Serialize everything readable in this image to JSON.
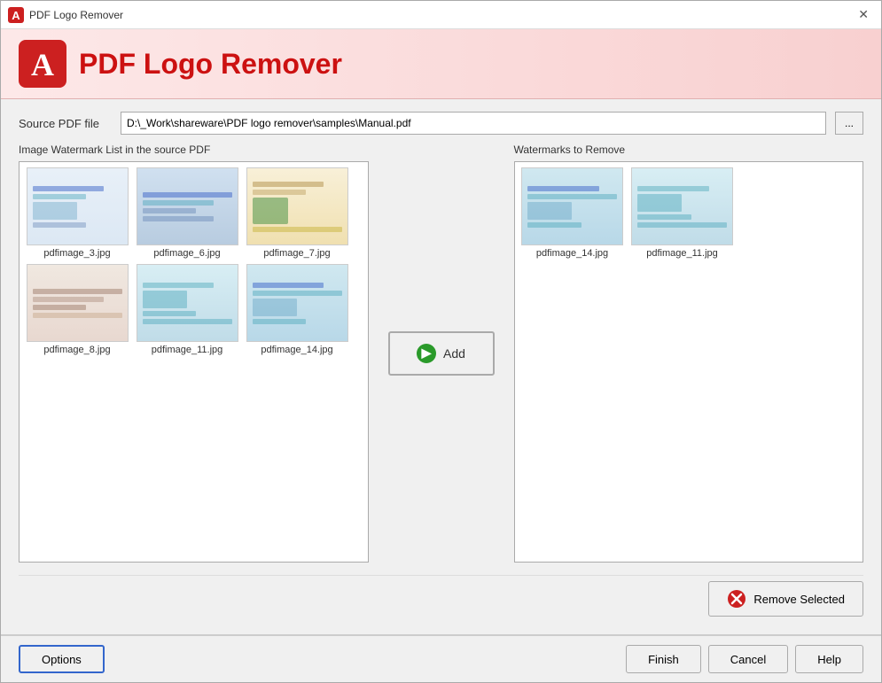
{
  "titleBar": {
    "icon": "pdf-logo-icon",
    "text": "PDF Logo Remover",
    "closeLabel": "✕"
  },
  "header": {
    "title": "PDF Logo Remover"
  },
  "sourceFile": {
    "label": "Source PDF file",
    "value": "D:\\_Work\\shareware\\PDF logo remover\\samples\\Manual.pdf",
    "browseBtnLabel": "..."
  },
  "leftPanel": {
    "label": "Image Watermark List in the source PDF",
    "items": [
      {
        "id": "pdfimage_3",
        "label": "pdfimage_3.jpg",
        "thumbClass": "thumb-3"
      },
      {
        "id": "pdfimage_6",
        "label": "pdfimage_6.jpg",
        "thumbClass": "thumb-6"
      },
      {
        "id": "pdfimage_7",
        "label": "pdfimage_7.jpg",
        "thumbClass": "thumb-7"
      },
      {
        "id": "pdfimage_8",
        "label": "pdfimage_8.jpg",
        "thumbClass": "thumb-8"
      },
      {
        "id": "pdfimage_11",
        "label": "pdfimage_11.jpg",
        "thumbClass": "thumb-11"
      },
      {
        "id": "pdfimage_14",
        "label": "pdfimage_14.jpg",
        "thumbClass": "thumb-14"
      }
    ]
  },
  "addButton": {
    "label": "Add"
  },
  "rightPanel": {
    "label": "Watermarks to Remove",
    "items": [
      {
        "id": "pdfimage_14r",
        "label": "pdfimage_14.jpg",
        "thumbClass": "thumb-14r"
      },
      {
        "id": "pdfimage_11r",
        "label": "pdfimage_11.jpg",
        "thumbClass": "thumb-11r"
      }
    ]
  },
  "removeSelectedBtn": {
    "label": "Remove Selected"
  },
  "footer": {
    "optionsLabel": "Options",
    "finishLabel": "Finish",
    "cancelLabel": "Cancel",
    "helpLabel": "Help"
  }
}
